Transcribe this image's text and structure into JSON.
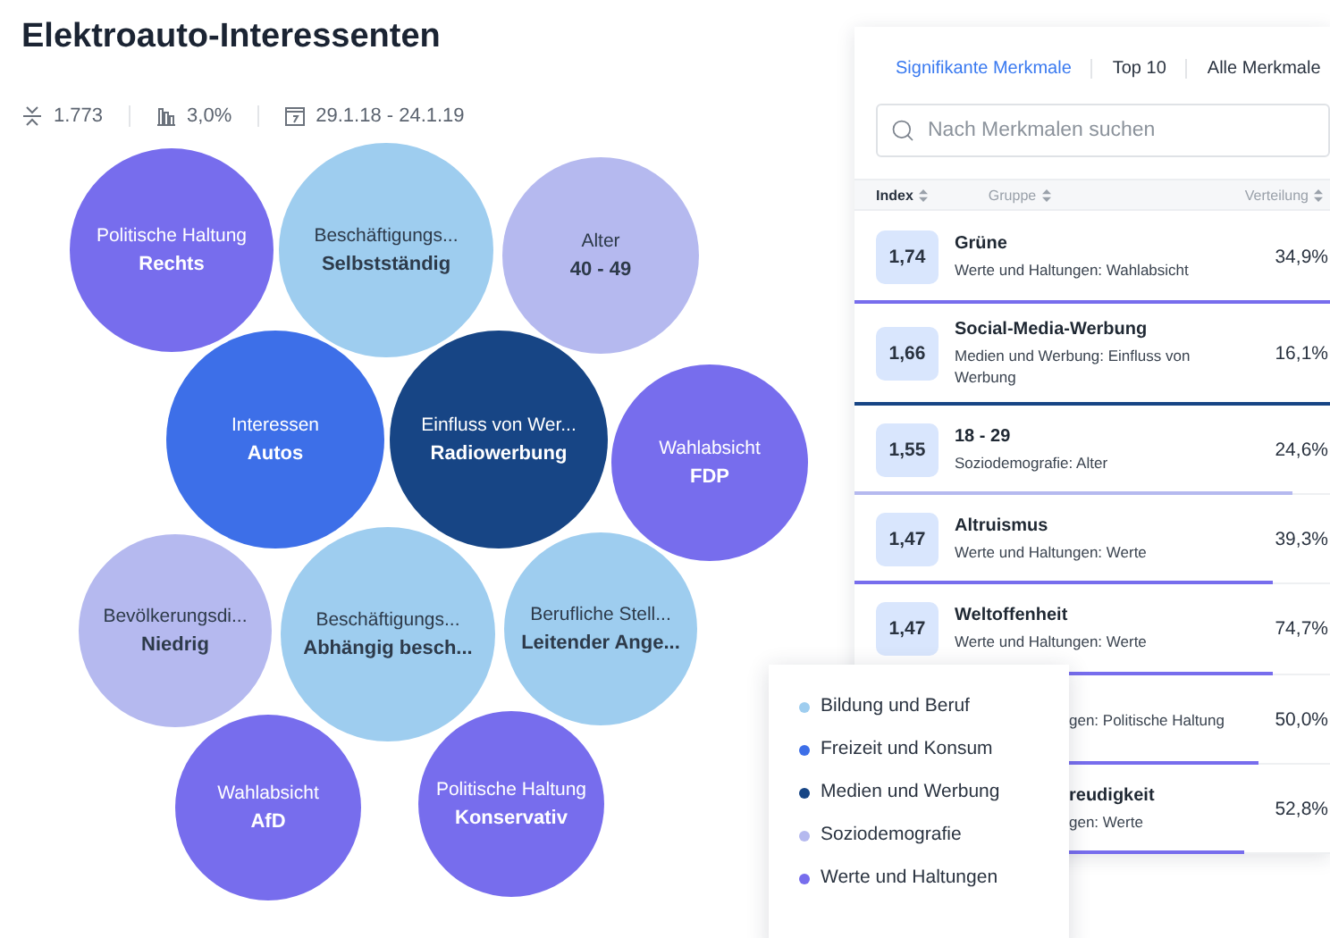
{
  "title": "Elektroauto-Interessenten",
  "stats": [
    {
      "kind": "people",
      "text": "1.773"
    },
    {
      "kind": "share",
      "text": "3,0%"
    },
    {
      "kind": "period",
      "text": "29.1.18 - 24.1.19"
    }
  ],
  "bubbles": [
    {
      "label": "Politische Haltung",
      "value": "Rechts",
      "color": "#776ded"
    },
    {
      "label": "Beschäftigungs...",
      "value": "Selbstständig",
      "color": "#9ecdef"
    },
    {
      "label": "Alter",
      "value": "40 - 49",
      "color": "#b5b9ef"
    },
    {
      "label": "Interessen",
      "value": "Autos",
      "color": "#3d6fe8"
    },
    {
      "label": "Einfluss von Wer...",
      "value": "Radiowerbung",
      "color": "#174585"
    },
    {
      "label": "Wahlabsicht",
      "value": "FDP",
      "color": "#776ded"
    },
    {
      "label": "Bevölkerungsdi...",
      "value": "Niedrig",
      "color": "#b5b9ef"
    },
    {
      "label": "Beschäftigungs...",
      "value": "Abhängig besch...",
      "color": "#9ecdef"
    },
    {
      "label": "Berufliche Stell...",
      "value": "Leitender Ange...",
      "color": "#9ecdef"
    },
    {
      "label": "Wahlabsicht",
      "value": "AfD",
      "color": "#776ded"
    },
    {
      "label": "Politische Haltung",
      "value": "Konservativ",
      "color": "#776ded"
    }
  ],
  "panel": {
    "tabs": [
      {
        "label": "Signifikante Merkmale",
        "selected": true
      },
      {
        "label": "Top 10",
        "selected": false
      },
      {
        "label": "Alle Merkmale",
        "selected": false
      }
    ],
    "search": {
      "placeholder": "Nach Merkmalen suchen"
    },
    "columns": [
      {
        "label": "Index",
        "sorted": true
      },
      {
        "label": "Gruppe",
        "sorted": false
      },
      {
        "label": "Verteilung",
        "sorted": false
      }
    ],
    "rows": [
      {
        "kind": "full",
        "index": "1,74",
        "name": "Grüne",
        "group": "Werte und Haltungen: Wahlabsicht",
        "share": "34,9%",
        "level": 1,
        "color": "#776ded"
      },
      {
        "kind": "full",
        "index": "1,66",
        "name": "Social-Media-Werbung",
        "group": "Medien und Werbung: Einfluss von Werbung",
        "share": "16,1%",
        "level": 1,
        "color": "#174585"
      },
      {
        "kind": "full",
        "index": "1,55",
        "name": "18 - 29",
        "group": "Soziodemografie: Alter",
        "share": "24,6%",
        "level": 0.92,
        "color": "#b5b9ef"
      },
      {
        "kind": "full",
        "index": "1,47",
        "name": "Altruismus",
        "group": "Werte und Haltungen: Werte",
        "share": "39,3%",
        "level": 0.88,
        "color": "#776ded"
      },
      {
        "kind": "full",
        "index": "1,47",
        "name": "Weltoffenheit",
        "group": "Werte und Haltungen: Werte",
        "share": "74,7%",
        "level": 0.88,
        "color": "#776ded"
      },
      {
        "kind": "covered",
        "group": "gen: Politische Haltung",
        "share": "50,0%",
        "level": 0.85,
        "color": "#776ded"
      },
      {
        "kind": "covered",
        "name": "reudigkeit",
        "group": "gen: Werte",
        "share": "52,8%",
        "level": 0.82,
        "color": "#776ded"
      }
    ]
  },
  "legend": [
    {
      "label": "Bildung und Beruf",
      "color": "#9ecdef"
    },
    {
      "label": "Freizeit und Konsum",
      "color": "#3d6fe8"
    },
    {
      "label": "Medien und Werbung",
      "color": "#174585"
    },
    {
      "label": "Soziodemografie",
      "color": "#b5b9ef"
    },
    {
      "label": "Werte und Haltungen",
      "color": "#776ded"
    }
  ]
}
